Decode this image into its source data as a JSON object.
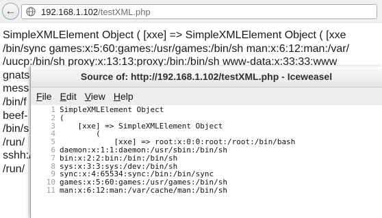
{
  "browser": {
    "back_icon": "back-arrow-icon",
    "url_icon": "globe-icon",
    "url_host": "192.168.1.102",
    "url_path": "/testXML.php"
  },
  "page_lines": [
    "SimpleXMLElement Object ( [xxe] => SimpleXMLElement Object ( [xxe",
    "/bin/sync games:x:5:60:games:/usr/games:/bin/sh man:x:6:12:man:/var/",
    "/uucp:/bin/sh proxy:x:13:13:proxy:/bin:/bin/sh www-data:x:33:33:www",
    "gnats",
    "mess",
    "/bin/f",
    "beef-",
    "/bin/s",
    "/run/",
    "sshh:/",
    "/run/"
  ],
  "source_window": {
    "title": "Source of: http://192.168.1.102/testXML.php - Iceweasel",
    "menu": [
      {
        "key": "F",
        "rest": "ile"
      },
      {
        "key": "E",
        "rest": "dit"
      },
      {
        "key": "V",
        "rest": "iew"
      },
      {
        "key": "H",
        "rest": "elp"
      }
    ],
    "lines": [
      {
        "num": "1",
        "text": "SimpleXMLElement Object"
      },
      {
        "num": "2",
        "text": "("
      },
      {
        "num": "3",
        "text": "    [xxe] => SimpleXMLElement Object"
      },
      {
        "num": "4",
        "text": "        ("
      },
      {
        "num": "5",
        "text": "            [xxe] => root:x:0:0:root:/root:/bin/bash"
      },
      {
        "num": "6",
        "text": "daemon:x:1:1:daemon:/usr/sbin:/bin/sh"
      },
      {
        "num": "7",
        "text": "bin:x:2:2:bin:/bin:/bin/sh"
      },
      {
        "num": "8",
        "text": "sys:x:3:3:sys:/dev:/bin/sh"
      },
      {
        "num": "9",
        "text": "sync:x:4:65534:sync:/bin:/bin/sync"
      },
      {
        "num": "10",
        "text": "games:x:5:60:games:/usr/games:/bin/sh"
      },
      {
        "num": "11",
        "text": "man:x:6:12:man:/var/cache/man:/bin/sh"
      }
    ]
  }
}
